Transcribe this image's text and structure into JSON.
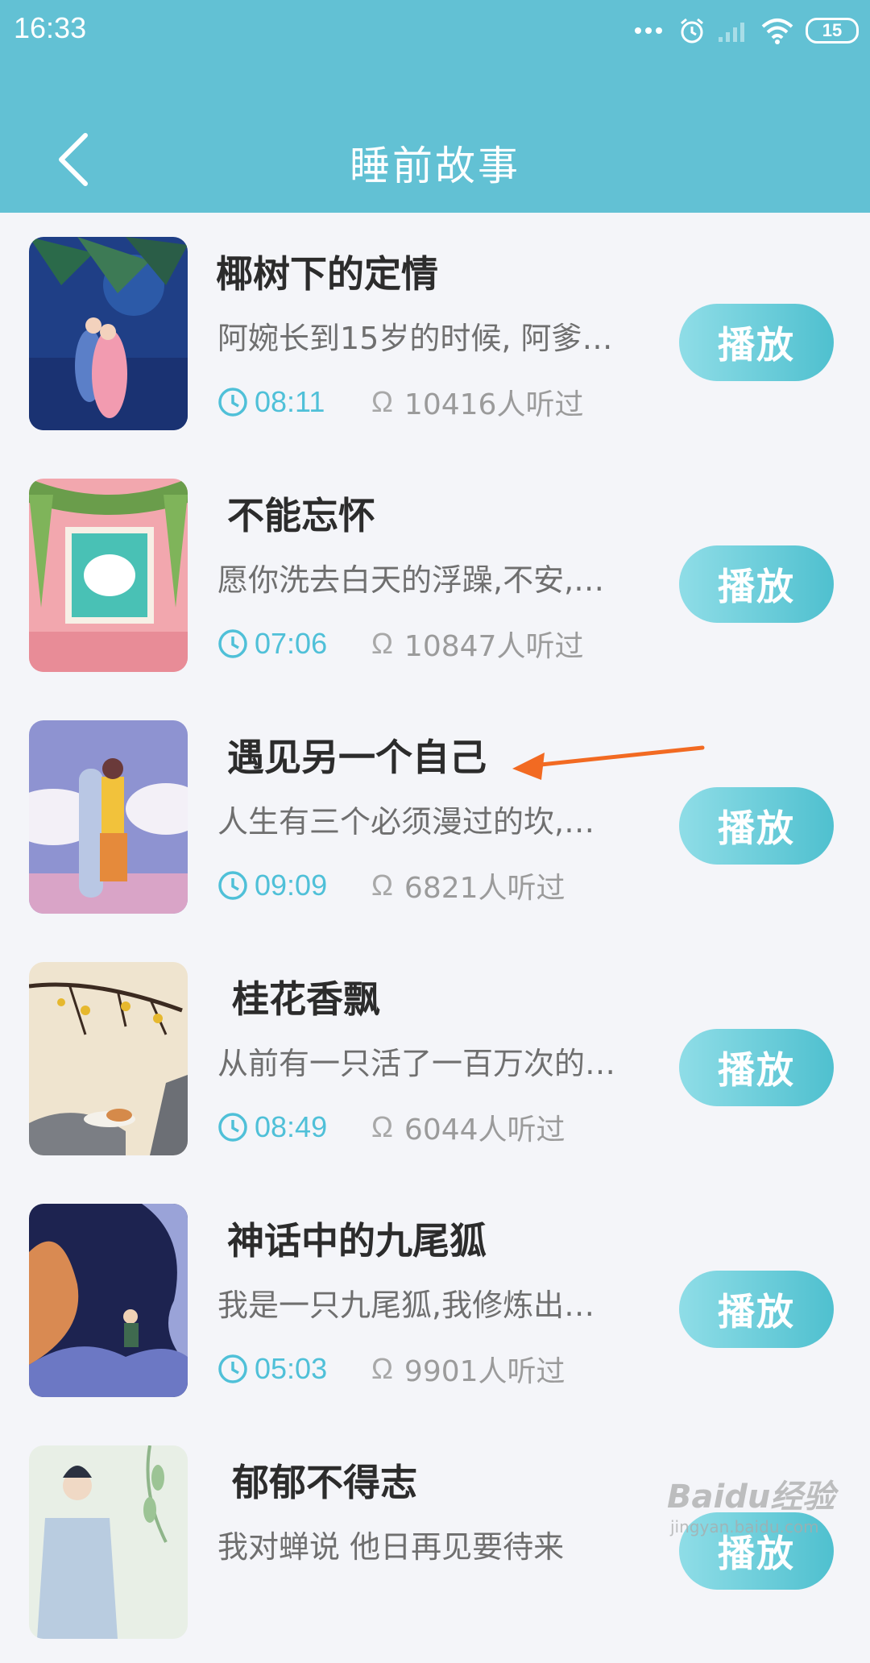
{
  "status_bar": {
    "time": "16:33",
    "battery": "15"
  },
  "header": {
    "title": "睡前故事",
    "back_icon": "chevron-left-icon"
  },
  "colors": {
    "header_bg": "#62c1d4",
    "accent": "#4fc0d8",
    "play_button": "#5ec6d3",
    "annotation_arrow": "#f26a22"
  },
  "stories": [
    {
      "title": "椰树下的定情",
      "description": "阿婉长到15岁的时候, 阿爹…",
      "duration": "08:11",
      "listens": "10416人听过",
      "play_label": "播放"
    },
    {
      "title": "不能忘怀",
      "description": "愿你洗去白天的浮躁,不安,…",
      "duration": "07:06",
      "listens": "10847人听过",
      "play_label": "播放"
    },
    {
      "title": "遇见另一个自己",
      "description": "人生有三个必须漫过的坎,…",
      "duration": "09:09",
      "listens": "6821人听过",
      "play_label": "播放"
    },
    {
      "title": "桂花香飘",
      "description": "从前有一只活了一百万次的…",
      "duration": "08:49",
      "listens": "6044人听过",
      "play_label": "播放"
    },
    {
      "title": "神话中的九尾狐",
      "description": "我是一只九尾狐,我修炼出…",
      "duration": "05:03",
      "listens": "9901人听过",
      "play_label": "播放"
    },
    {
      "title": "郁郁不得志",
      "description": "我对蝉说 他日再见要待来",
      "duration": "",
      "listens": "",
      "play_label": "播放"
    }
  ],
  "listens_symbol": "Ω",
  "watermark": {
    "main": "Baidu经验",
    "sub": "jingyan.baidu.com"
  }
}
